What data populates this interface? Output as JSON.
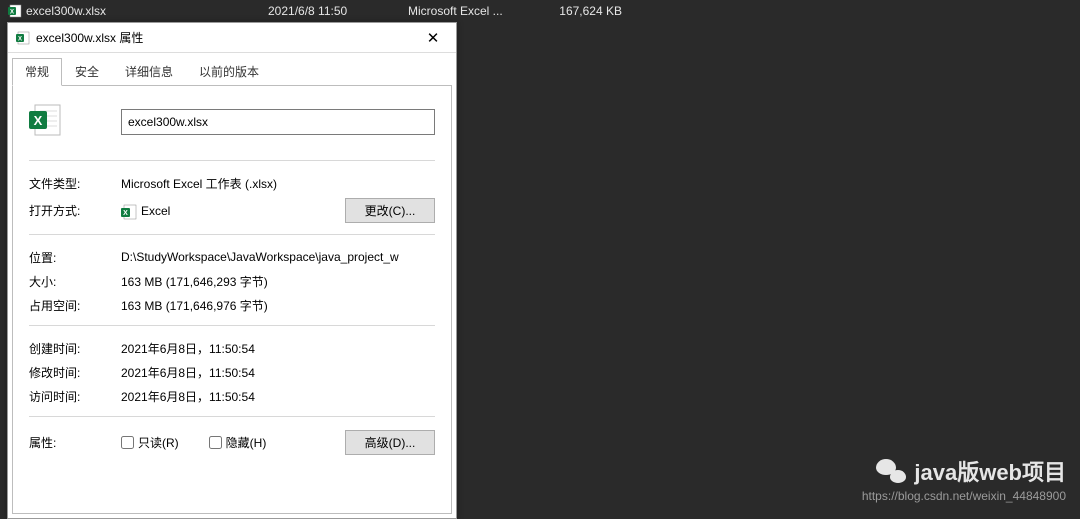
{
  "explorer": {
    "filename": "excel300w.xlsx",
    "date": "2021/6/8 11:50",
    "type": "Microsoft Excel ...",
    "size": "167,624 KB"
  },
  "dialog": {
    "title": "excel300w.xlsx 属性",
    "close": "✕",
    "tabs": [
      "常规",
      "安全",
      "详细信息",
      "以前的版本"
    ],
    "filename": "excel300w.xlsx",
    "fields": {
      "file_type_label": "文件类型:",
      "file_type_value": "Microsoft Excel 工作表 (.xlsx)",
      "open_with_label": "打开方式:",
      "open_with_app": "Excel",
      "change_btn": "更改(C)...",
      "location_label": "位置:",
      "location_value": "D:\\StudyWorkspace\\JavaWorkspace\\java_project_w",
      "size_label": "大小:",
      "size_value": "163 MB (171,646,293 字节)",
      "disk_label": "占用空间:",
      "disk_value": "163 MB (171,646,976 字节)",
      "created_label": "创建时间:",
      "created_value": "2021年6月8日，11:50:54",
      "modified_label": "修改时间:",
      "modified_value": "2021年6月8日，11:50:54",
      "accessed_label": "访问时间:",
      "accessed_value": "2021年6月8日，11:50:54",
      "attr_label": "属性:",
      "readonly_label": "只读(R)",
      "hidden_label": "隐藏(H)",
      "advanced_btn": "高级(D)..."
    }
  },
  "watermark": {
    "title": "java版web项目",
    "url": "https://blog.csdn.net/weixin_44848900"
  }
}
